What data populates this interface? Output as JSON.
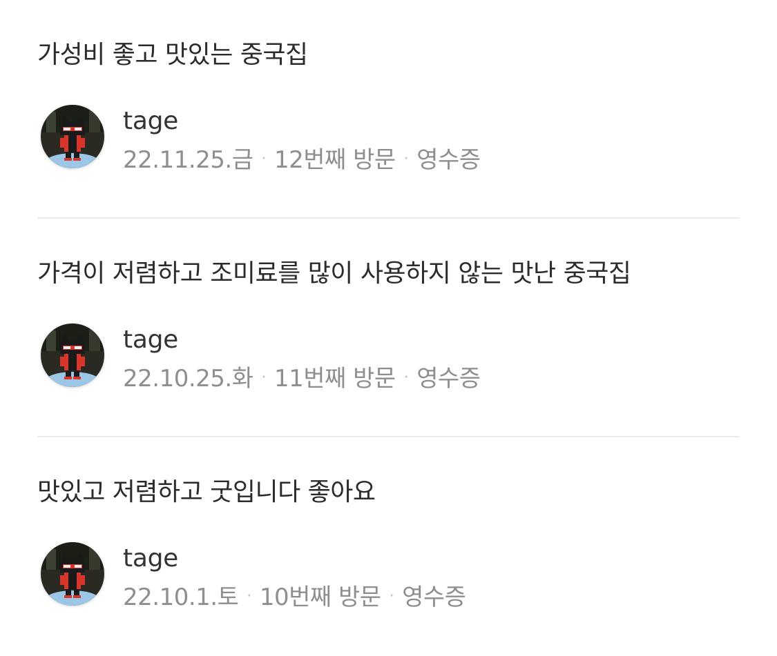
{
  "reviews": [
    {
      "text": "가성비 좋고 맛있는 중국집",
      "author": "tage",
      "date": "22.11.25.금",
      "visit": "12번째 방문",
      "receipt": "영수증"
    },
    {
      "text": "가격이 저렴하고 조미료를 많이 사용하지 않는 맛난 중국집",
      "author": "tage",
      "date": "22.10.25.화",
      "visit": "11번째 방문",
      "receipt": "영수증"
    },
    {
      "text": "맛있고 저렴하고 굿입니다 좋아요",
      "author": "tage",
      "date": "22.10.1.토",
      "visit": "10번째 방문",
      "receipt": "영수증"
    }
  ],
  "separator": "·",
  "colors": {
    "text": "#2b2b2b",
    "meta": "#8e8e8e",
    "divider": "#eaeaea"
  }
}
